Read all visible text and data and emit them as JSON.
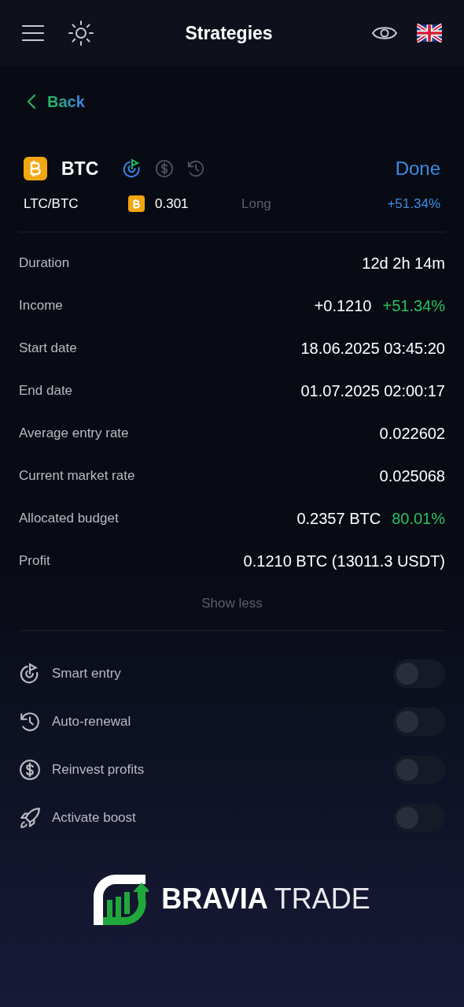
{
  "header": {
    "title": "Strategies"
  },
  "back": {
    "label": "Back"
  },
  "strategy": {
    "coin": "BTC",
    "status": "Done",
    "pair": "LTC/BTC",
    "amount": "0.301",
    "side": "Long",
    "change": "+51.34%",
    "features": [
      {
        "kind": "smart",
        "active": true
      },
      {
        "kind": "reinvest",
        "active": false
      },
      {
        "kind": "renewal",
        "active": false
      }
    ]
  },
  "details": [
    {
      "label": "Duration",
      "value": "12d 2h 14m"
    },
    {
      "label": "Income",
      "value": "+0.1210",
      "extra": "+51.34%"
    },
    {
      "label": "Start date",
      "value": "18.06.2025 03:45:20"
    },
    {
      "label": "End date",
      "value": "01.07.2025 02:00:17"
    },
    {
      "label": "Average entry rate",
      "value": "0.022602"
    },
    {
      "label": "Current market rate",
      "value": "0.025068"
    },
    {
      "label": "Allocated budget",
      "value": "0.2357 BTC",
      "extra": "80.01%"
    },
    {
      "label": "Profit",
      "value": "0.1210 BTC (13011.3 USDT)"
    }
  ],
  "show_less": "Show less",
  "options": [
    {
      "kind": "smart",
      "label": "Smart entry",
      "on": false
    },
    {
      "kind": "renewal",
      "label": "Auto-renewal",
      "on": false
    },
    {
      "kind": "reinvest",
      "label": "Reinvest profits",
      "on": false
    },
    {
      "kind": "boost",
      "label": "Activate boost",
      "on": false
    }
  ],
  "brand": {
    "bold": "BRAVIA",
    "light": "TRADE"
  }
}
